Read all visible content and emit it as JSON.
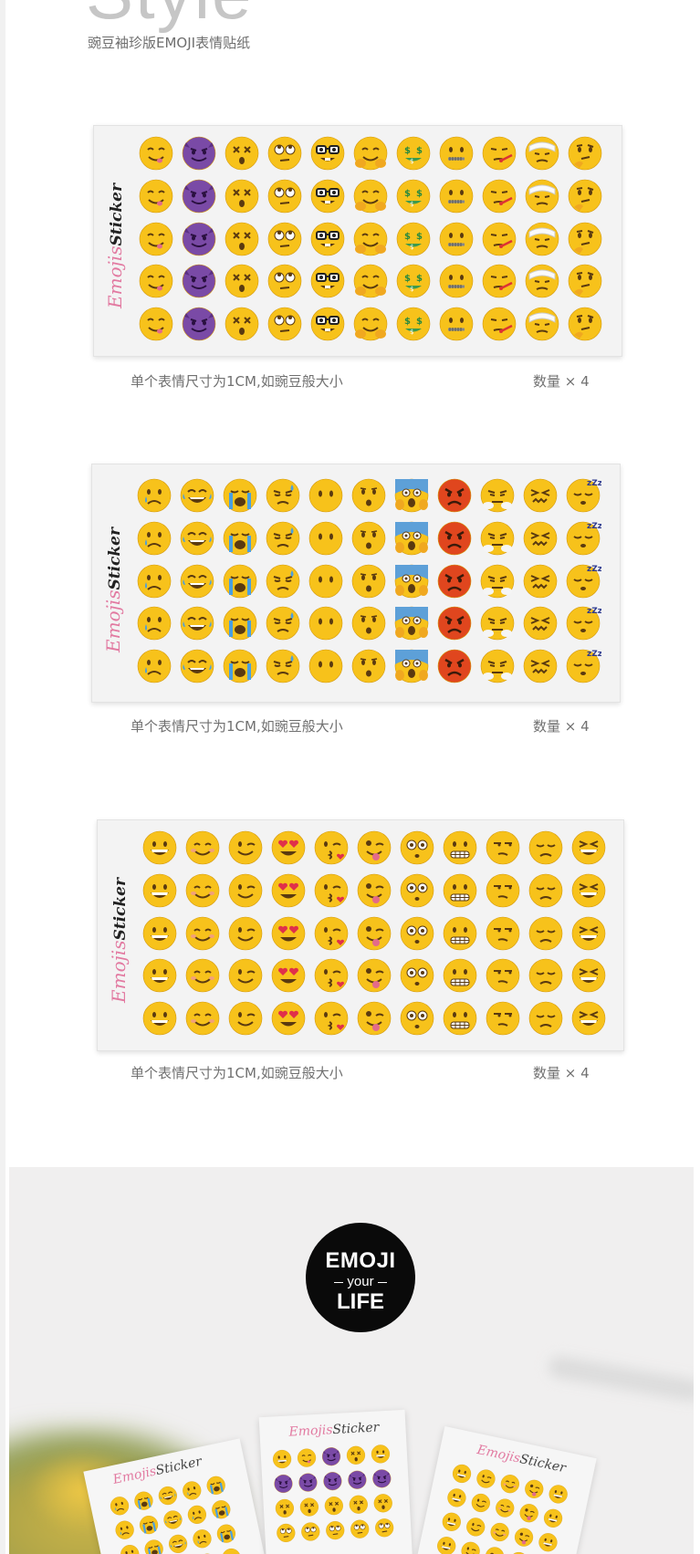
{
  "header": {
    "title": "Style",
    "subtitle": "豌豆袖珍版EMOJI表情贴纸"
  },
  "sheets": [
    {
      "brand_pink": "Emojis",
      "brand_dark": "Sticker",
      "columns": [
        "smile-tongue-icon",
        "devil-icon",
        "dizzy-face-icon",
        "rolling-eyes-icon",
        "nerd-glasses-icon",
        "hugging-icon",
        "money-mouth-icon",
        "zipper-mouth-icon",
        "thermometer-face-icon",
        "bandage-face-icon",
        "thinking-icon"
      ],
      "rows": 5,
      "caption": "单个表情尺寸为1CM,如豌豆般大小",
      "quantity": "数量 × 4"
    },
    {
      "brand_pink": "Emojis",
      "brand_dark": "Sticker",
      "columns": [
        "crying-tear-icon",
        "laughing-tears-icon",
        "sobbing-icon",
        "sad-sweat-icon",
        "no-mouth-icon",
        "hushed-icon",
        "screaming-fear-icon",
        "angry-red-icon",
        "steam-nose-icon",
        "confounded-icon",
        "sleeping-zzz-icon"
      ],
      "rows": 5,
      "caption": "单个表情尺寸为1CM,如豌豆般大小",
      "quantity": "数量 × 4"
    },
    {
      "brand_pink": "Emojis",
      "brand_dark": "Sticker",
      "columns": [
        "grinning-icon",
        "blushing-smile-icon",
        "winking-icon",
        "heart-eyes-icon",
        "kiss-heart-icon",
        "tongue-wink-icon",
        "flushed-icon",
        "grimacing-icon",
        "unamused-icon",
        "disappointed-icon",
        "squinting-laugh-icon"
      ],
      "rows": 5,
      "caption": "单个表情尺寸为1CM,如豌豆般大小",
      "quantity": "数量 × 4"
    }
  ],
  "promo": {
    "badge_top": "EMOJI",
    "badge_mid": "your",
    "badge_bottom": "LIFE",
    "mini_brand_pink": "Emojis",
    "mini_brand_dark": "Sticker"
  },
  "colors": {
    "emoji_yellow": "#f7c21b",
    "devil_purple": "#7a4aa6",
    "angry_red": "#e0461e",
    "brand_pink": "#e27aa1"
  }
}
